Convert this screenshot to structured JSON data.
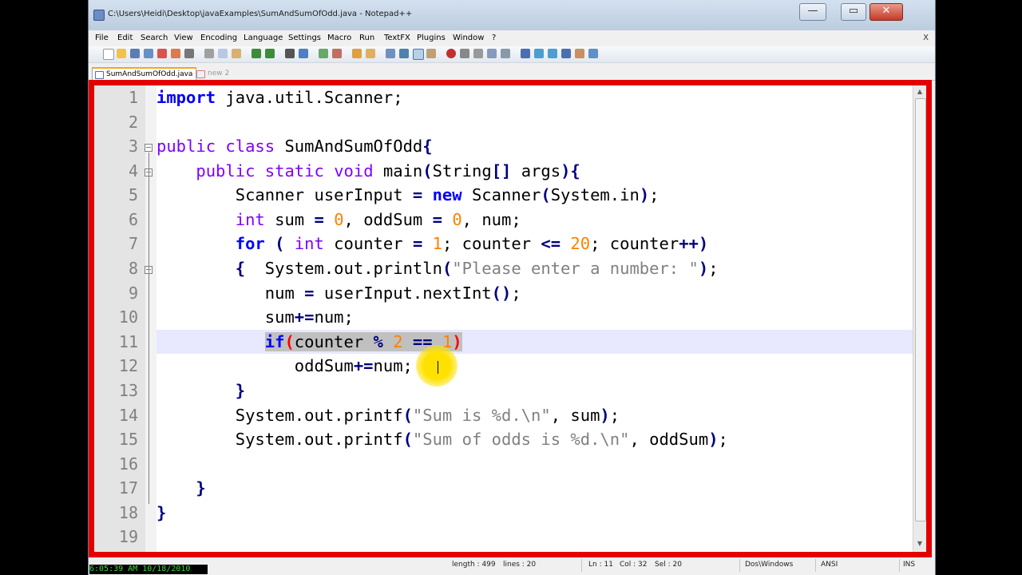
{
  "window": {
    "title": "C:\\Users\\Heidi\\Desktop\\javaExamples\\SumAndSumOfOdd.java - Notepad++",
    "minimize_label": "—",
    "maximize_label": "▭",
    "close_label": "✕"
  },
  "menu": {
    "items": [
      "File",
      "Edit",
      "Search",
      "View",
      "Encoding",
      "Language",
      "Settings",
      "Macro",
      "Run",
      "TextFX",
      "Plugins",
      "Window",
      "?"
    ],
    "close_label": "X"
  },
  "tabs": [
    {
      "label": "SumAndSumOfOdd.java",
      "active": true
    },
    {
      "label": "new 2",
      "active": false
    }
  ],
  "editor": {
    "line_numbers": [
      "1",
      "2",
      "3",
      "4",
      "5",
      "6",
      "7",
      "8",
      "9",
      "10",
      "11",
      "12",
      "13",
      "14",
      "15",
      "16",
      "17",
      "18",
      "19"
    ],
    "current_line": 11
  },
  "status": {
    "length": "length : 499",
    "lines": "lines : 20",
    "ln": "Ln : 11",
    "col": "Col : 32",
    "sel": "Sel : 20",
    "eol": "Dos\\Windows",
    "encoding": "ANSI",
    "mode": "INS"
  },
  "overlay": {
    "clock": "6:05:39 AM 10/18/2010"
  },
  "colors": {
    "keyword": "#0000ff",
    "type": "#8000ff",
    "number": "#ff8000",
    "string": "#808080",
    "operator": "#000080",
    "highlight_frame": "#e50000",
    "cursor_highlight": "#ffe100"
  }
}
